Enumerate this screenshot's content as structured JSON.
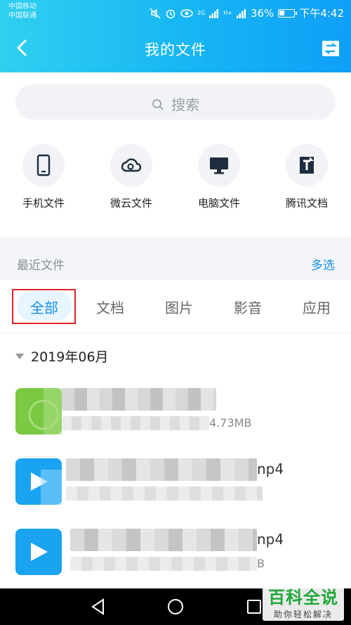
{
  "status_bar": {
    "carrier_1": "中国移动",
    "carrier_2": "中国联通",
    "network_1": "2G",
    "network_2": "H+",
    "battery": "36%",
    "time": "下午4:42"
  },
  "header": {
    "title": "我的文件",
    "back_icon": "chevron-left-icon",
    "transfer_icon": "transfer-icon",
    "bg_colors": [
      "#2fd0f0",
      "#0f9ff7"
    ]
  },
  "search": {
    "placeholder": "搜索"
  },
  "shortcuts": [
    {
      "label": "手机文件",
      "icon": "phone-icon"
    },
    {
      "label": "微云文件",
      "icon": "cloud-icon"
    },
    {
      "label": "电脑文件",
      "icon": "computer-icon"
    },
    {
      "label": "腾讯文档",
      "icon": "tencent-doc-icon"
    }
  ],
  "recent": {
    "label": "最近文件",
    "multi_select": "多选"
  },
  "tabs": [
    {
      "label": "全部",
      "active": true
    },
    {
      "label": "文档",
      "active": false
    },
    {
      "label": "图片",
      "active": false
    },
    {
      "label": "影音",
      "active": false
    },
    {
      "label": "应用",
      "active": false
    }
  ],
  "group": {
    "date": "2019年06月"
  },
  "files": [
    {
      "icon": "apk-icon",
      "icon_color": "#7ac943",
      "name_visible": "",
      "meta_visible": "4.73MB"
    },
    {
      "icon": "video-icon",
      "icon_color": "#1aa3f0",
      "name_visible": "np4",
      "meta_visible": ""
    },
    {
      "icon": "video-icon",
      "icon_color": "#1aa3f0",
      "name_visible": "np4",
      "meta_visible": "B"
    }
  ],
  "nav": {
    "back": "back-triangle-icon",
    "home": "home-circle-icon",
    "recent": "recent-square-icon"
  },
  "watermark": {
    "title": "百科全说",
    "subtitle": "助你轻松解决"
  },
  "colors": {
    "accent": "#1590e8",
    "highlight": "#e0242a"
  }
}
